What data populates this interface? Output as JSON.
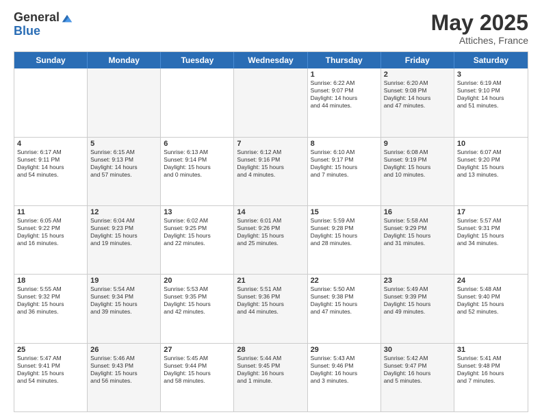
{
  "logo": {
    "general": "General",
    "blue": "Blue"
  },
  "title": "May 2025",
  "location": "Attiches, France",
  "days": [
    "Sunday",
    "Monday",
    "Tuesday",
    "Wednesday",
    "Thursday",
    "Friday",
    "Saturday"
  ],
  "rows": [
    [
      {
        "num": "",
        "text": "",
        "empty": true
      },
      {
        "num": "",
        "text": "",
        "empty": true
      },
      {
        "num": "",
        "text": "",
        "empty": true
      },
      {
        "num": "",
        "text": "",
        "empty": true
      },
      {
        "num": "1",
        "text": "Sunrise: 6:22 AM\nSunset: 9:07 PM\nDaylight: 14 hours\nand 44 minutes."
      },
      {
        "num": "2",
        "text": "Sunrise: 6:20 AM\nSunset: 9:08 PM\nDaylight: 14 hours\nand 47 minutes."
      },
      {
        "num": "3",
        "text": "Sunrise: 6:19 AM\nSunset: 9:10 PM\nDaylight: 14 hours\nand 51 minutes."
      }
    ],
    [
      {
        "num": "4",
        "text": "Sunrise: 6:17 AM\nSunset: 9:11 PM\nDaylight: 14 hours\nand 54 minutes."
      },
      {
        "num": "5",
        "text": "Sunrise: 6:15 AM\nSunset: 9:13 PM\nDaylight: 14 hours\nand 57 minutes."
      },
      {
        "num": "6",
        "text": "Sunrise: 6:13 AM\nSunset: 9:14 PM\nDaylight: 15 hours\nand 0 minutes."
      },
      {
        "num": "7",
        "text": "Sunrise: 6:12 AM\nSunset: 9:16 PM\nDaylight: 15 hours\nand 4 minutes."
      },
      {
        "num": "8",
        "text": "Sunrise: 6:10 AM\nSunset: 9:17 PM\nDaylight: 15 hours\nand 7 minutes."
      },
      {
        "num": "9",
        "text": "Sunrise: 6:08 AM\nSunset: 9:19 PM\nDaylight: 15 hours\nand 10 minutes."
      },
      {
        "num": "10",
        "text": "Sunrise: 6:07 AM\nSunset: 9:20 PM\nDaylight: 15 hours\nand 13 minutes."
      }
    ],
    [
      {
        "num": "11",
        "text": "Sunrise: 6:05 AM\nSunset: 9:22 PM\nDaylight: 15 hours\nand 16 minutes."
      },
      {
        "num": "12",
        "text": "Sunrise: 6:04 AM\nSunset: 9:23 PM\nDaylight: 15 hours\nand 19 minutes."
      },
      {
        "num": "13",
        "text": "Sunrise: 6:02 AM\nSunset: 9:25 PM\nDaylight: 15 hours\nand 22 minutes."
      },
      {
        "num": "14",
        "text": "Sunrise: 6:01 AM\nSunset: 9:26 PM\nDaylight: 15 hours\nand 25 minutes."
      },
      {
        "num": "15",
        "text": "Sunrise: 5:59 AM\nSunset: 9:28 PM\nDaylight: 15 hours\nand 28 minutes."
      },
      {
        "num": "16",
        "text": "Sunrise: 5:58 AM\nSunset: 9:29 PM\nDaylight: 15 hours\nand 31 minutes."
      },
      {
        "num": "17",
        "text": "Sunrise: 5:57 AM\nSunset: 9:31 PM\nDaylight: 15 hours\nand 34 minutes."
      }
    ],
    [
      {
        "num": "18",
        "text": "Sunrise: 5:55 AM\nSunset: 9:32 PM\nDaylight: 15 hours\nand 36 minutes."
      },
      {
        "num": "19",
        "text": "Sunrise: 5:54 AM\nSunset: 9:34 PM\nDaylight: 15 hours\nand 39 minutes."
      },
      {
        "num": "20",
        "text": "Sunrise: 5:53 AM\nSunset: 9:35 PM\nDaylight: 15 hours\nand 42 minutes."
      },
      {
        "num": "21",
        "text": "Sunrise: 5:51 AM\nSunset: 9:36 PM\nDaylight: 15 hours\nand 44 minutes."
      },
      {
        "num": "22",
        "text": "Sunrise: 5:50 AM\nSunset: 9:38 PM\nDaylight: 15 hours\nand 47 minutes."
      },
      {
        "num": "23",
        "text": "Sunrise: 5:49 AM\nSunset: 9:39 PM\nDaylight: 15 hours\nand 49 minutes."
      },
      {
        "num": "24",
        "text": "Sunrise: 5:48 AM\nSunset: 9:40 PM\nDaylight: 15 hours\nand 52 minutes."
      }
    ],
    [
      {
        "num": "25",
        "text": "Sunrise: 5:47 AM\nSunset: 9:41 PM\nDaylight: 15 hours\nand 54 minutes."
      },
      {
        "num": "26",
        "text": "Sunrise: 5:46 AM\nSunset: 9:43 PM\nDaylight: 15 hours\nand 56 minutes."
      },
      {
        "num": "27",
        "text": "Sunrise: 5:45 AM\nSunset: 9:44 PM\nDaylight: 15 hours\nand 58 minutes."
      },
      {
        "num": "28",
        "text": "Sunrise: 5:44 AM\nSunset: 9:45 PM\nDaylight: 16 hours\nand 1 minute."
      },
      {
        "num": "29",
        "text": "Sunrise: 5:43 AM\nSunset: 9:46 PM\nDaylight: 16 hours\nand 3 minutes."
      },
      {
        "num": "30",
        "text": "Sunrise: 5:42 AM\nSunset: 9:47 PM\nDaylight: 16 hours\nand 5 minutes."
      },
      {
        "num": "31",
        "text": "Sunrise: 5:41 AM\nSunset: 9:48 PM\nDaylight: 16 hours\nand 7 minutes."
      }
    ]
  ]
}
